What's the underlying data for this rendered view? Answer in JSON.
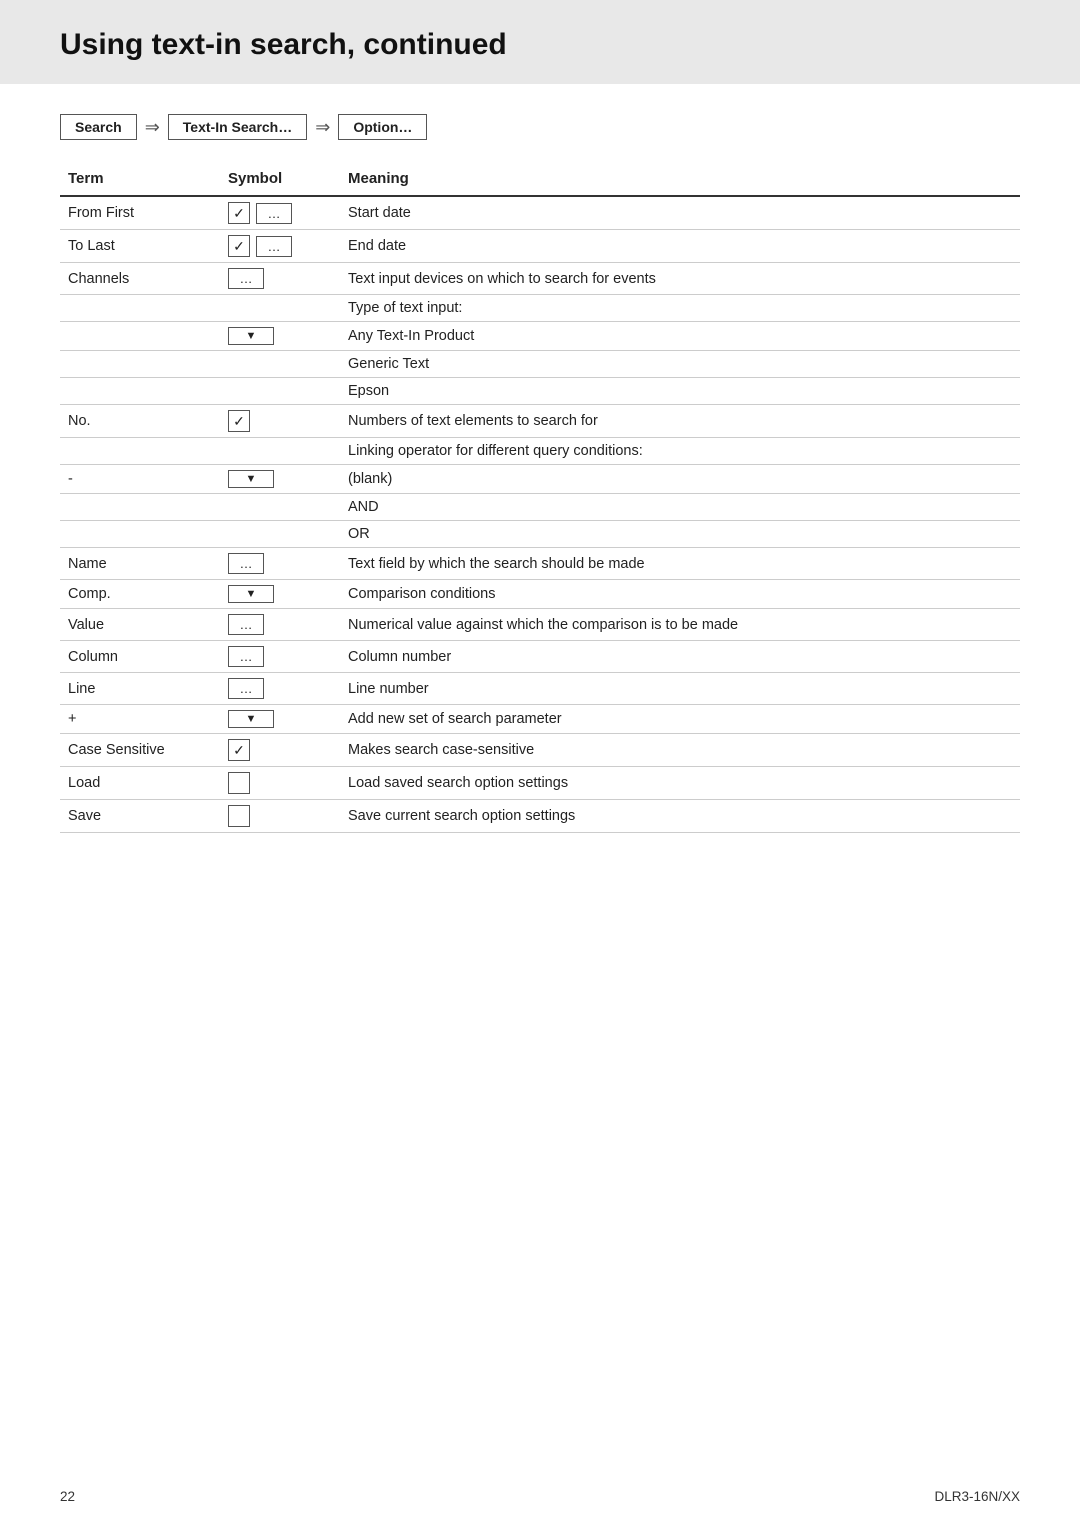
{
  "page": {
    "title": "Using text-in search, continued",
    "page_number": "22",
    "product_code": "DLR3-16N/XX"
  },
  "breadcrumb": {
    "items": [
      "Search",
      "Text-In Search…",
      "Option…"
    ]
  },
  "table": {
    "headers": [
      "Term",
      "Symbol",
      "Meaning"
    ],
    "rows": [
      {
        "term": "From First",
        "symbol_type": "checkbox_ellipsis",
        "meaning": "Start date"
      },
      {
        "term": "To Last",
        "symbol_type": "checkbox_ellipsis",
        "meaning": "End date"
      },
      {
        "term": "Channels",
        "symbol_type": "ellipsis_only",
        "meaning": "Text input devices on which to search for events"
      },
      {
        "term": "",
        "symbol_type": "none",
        "meaning": "Type of text input:"
      },
      {
        "term": "",
        "symbol_type": "dropdown",
        "meaning": "Any Text-In Product"
      },
      {
        "term": "",
        "symbol_type": "none",
        "meaning": "Generic Text"
      },
      {
        "term": "",
        "symbol_type": "none",
        "meaning": "Epson"
      },
      {
        "term": "No.",
        "symbol_type": "checkbox_only",
        "meaning": "Numbers of text elements to search for"
      },
      {
        "term": "",
        "symbol_type": "none",
        "meaning": "Linking operator for different query conditions:"
      },
      {
        "term": "-",
        "symbol_type": "dropdown",
        "meaning": "(blank)"
      },
      {
        "term": "",
        "symbol_type": "none",
        "meaning": "AND"
      },
      {
        "term": "",
        "symbol_type": "none",
        "meaning": "OR"
      },
      {
        "term": "Name",
        "symbol_type": "ellipsis_only",
        "meaning": "Text field by which the search should be made"
      },
      {
        "term": "Comp.",
        "symbol_type": "dropdown",
        "meaning": "Comparison conditions"
      },
      {
        "term": "Value",
        "symbol_type": "ellipsis_only",
        "meaning": "Numerical value against which the comparison is to be made"
      },
      {
        "term": "Column",
        "symbol_type": "ellipsis_only",
        "meaning": "Column number"
      },
      {
        "term": "Line",
        "symbol_type": "ellipsis_only",
        "meaning": "Line number"
      },
      {
        "term": "+",
        "symbol_type": "dropdown",
        "meaning": "Add new set of search parameter"
      },
      {
        "term": "Case Sensitive",
        "symbol_type": "checkbox_only",
        "meaning": "Makes search case-sensitive"
      },
      {
        "term": "Load",
        "symbol_type": "plain_box",
        "meaning": "Load saved search option settings"
      },
      {
        "term": "Save",
        "symbol_type": "plain_box",
        "meaning": "Save current search option settings"
      }
    ]
  }
}
